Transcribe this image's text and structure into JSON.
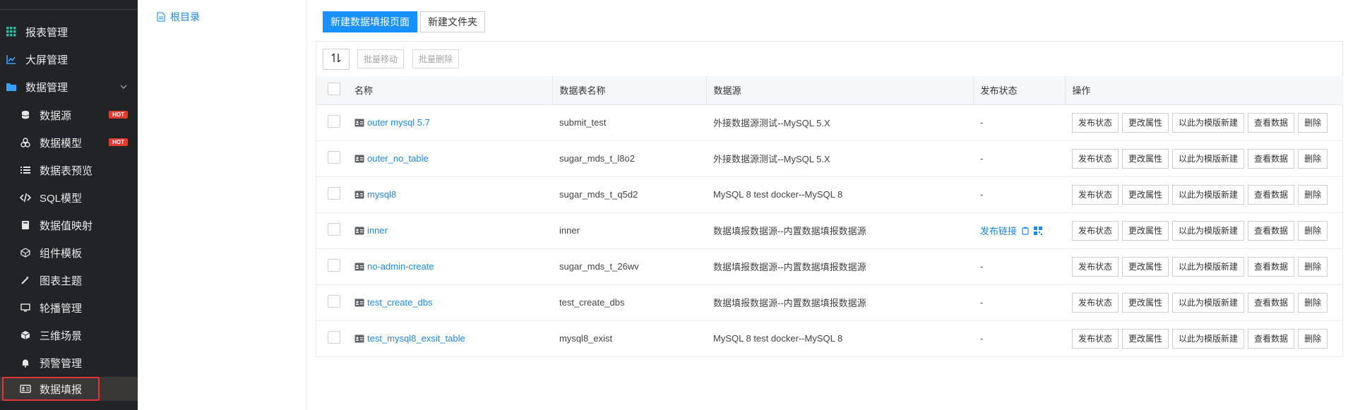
{
  "sidebar": {
    "items": [
      {
        "label": "报表管理",
        "icon": "grid-icon"
      },
      {
        "label": "大屏管理",
        "icon": "line-chart-icon"
      },
      {
        "label": "数据管理",
        "icon": "folder-icon"
      },
      {
        "label": "数据源",
        "icon": "database-icon",
        "badge": "HOT"
      },
      {
        "label": "数据模型",
        "icon": "model-icon",
        "badge": "HOT"
      },
      {
        "label": "数据表预览",
        "icon": "list-icon"
      },
      {
        "label": "SQL模型",
        "icon": "code-icon"
      },
      {
        "label": "数据值映射",
        "icon": "book-icon"
      },
      {
        "label": "组件模板",
        "icon": "cube-icon"
      },
      {
        "label": "图表主题",
        "icon": "wand-icon"
      },
      {
        "label": "轮播管理",
        "icon": "monitor-icon"
      },
      {
        "label": "三维场景",
        "icon": "box-3d-icon"
      },
      {
        "label": "预警管理",
        "icon": "bell-icon"
      },
      {
        "label": "数据填报",
        "icon": "id-card-icon"
      }
    ]
  },
  "tree": {
    "root_label": "根目录"
  },
  "main": {
    "new_page_label": "新建数据填报页面",
    "new_folder_label": "新建文件夹",
    "batch_move_label": "批量移动",
    "batch_delete_label": "批量删除"
  },
  "table": {
    "headers": [
      "名称",
      "数据表名称",
      "数据源",
      "发布状态",
      "操作"
    ],
    "rows": [
      {
        "name": "outer mysql 5.7",
        "table": "submit_test",
        "source": "外接数据源测试--MySQL 5.X",
        "status": "-"
      },
      {
        "name": "outer_no_table",
        "table": "sugar_mds_t_l8o2",
        "source": "外接数据源测试--MySQL 5.X",
        "status": "-"
      },
      {
        "name": "mysql8",
        "table": "sugar_mds_t_q5d2",
        "source": "MySQL 8 test docker--MySQL 8",
        "status": "-"
      },
      {
        "name": "inner",
        "table": "inner",
        "source": "数据填报数据源--内置数据填报数据源",
        "status": "发布链接"
      },
      {
        "name": "no-admin-create",
        "table": "sugar_mds_t_26wv",
        "source": "数据填报数据源--内置数据填报数据源",
        "status": "-"
      },
      {
        "name": "test_create_dbs",
        "table": "test_create_dbs",
        "source": "数据填报数据源--内置数据填报数据源",
        "status": "-"
      },
      {
        "name": "test_mysql8_exsit_table",
        "table": "mysql8_exist",
        "source": "MySQL 8 test docker--MySQL 8",
        "status": "-"
      }
    ],
    "ops": [
      "发布状态",
      "更改属性",
      "以此为模版新建",
      "查看数据",
      "删除"
    ]
  }
}
